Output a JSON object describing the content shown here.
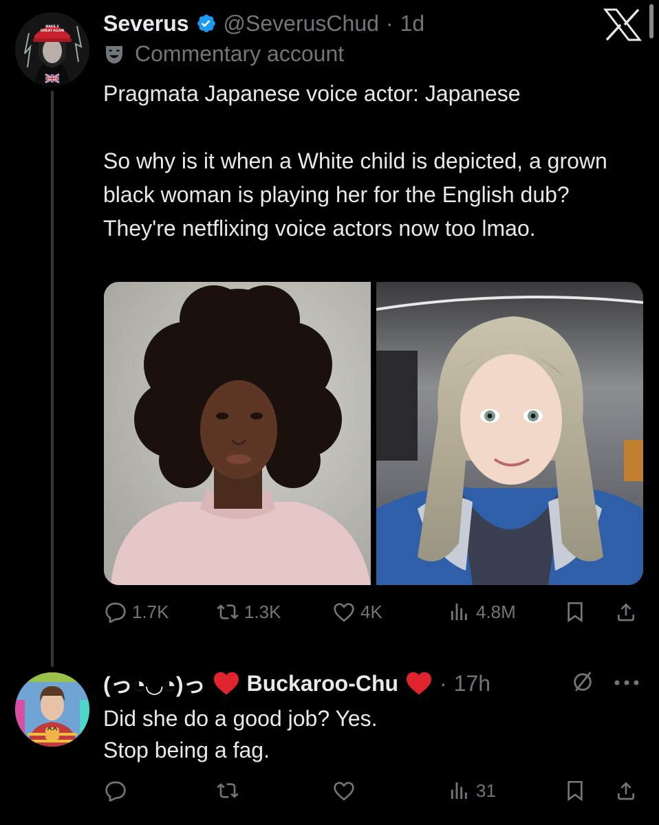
{
  "tweet": {
    "display_name": "Severus",
    "handle": "@SeverusChud",
    "separator": "·",
    "time": "1d",
    "label": "Commentary account",
    "text": "Pragmata Japanese voice actor: Japanese\n\nSo why is it when a White child is depicted, a grown black woman is playing her for the English dub? They're netflixing voice actors now too lmao.",
    "hat_text": "MAKE X\nGREAT AGAIN",
    "stats": {
      "replies": "1.7K",
      "reposts": "1.3K",
      "likes": "4K",
      "views": "4.8M"
    }
  },
  "reply": {
    "kaomoji": "(っ◔◡◔)っ",
    "display_name": "Buckaroo-Chu",
    "separator": "·",
    "time": "17h",
    "text": "Did she do a good job? Yes.\nStop being a fag.",
    "stats": {
      "views": "31"
    }
  },
  "colors": {
    "background": "#000000",
    "text": "#e7e9ea",
    "muted": "#71767b",
    "verified": "#1d9bf0",
    "heart": "#e0242e"
  },
  "icons": [
    "x-logo-icon",
    "verified-icon",
    "theater-mask-icon",
    "reply-icon",
    "repost-icon",
    "like-icon",
    "views-icon",
    "bookmark-icon",
    "share-icon",
    "heart-emoji-icon",
    "mute-icon",
    "more-icon"
  ]
}
